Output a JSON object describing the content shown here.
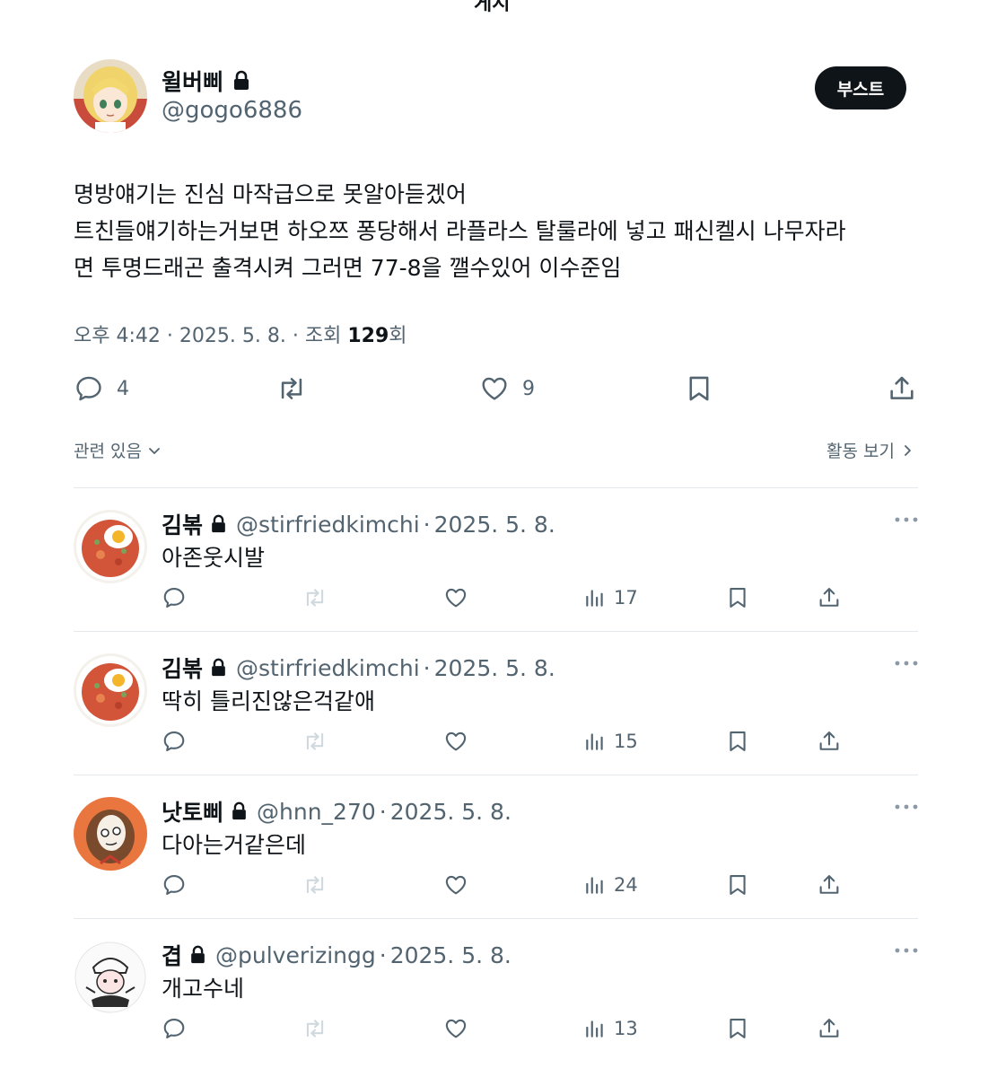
{
  "header_partial": "게시",
  "main_post": {
    "author_name": "윌버삐",
    "author_handle": "@gogo6886",
    "boost_label": "부스트",
    "text_lines": [
      "명방얘기는 진심 마작급으로 못알아듣겠어",
      "트친들얘기하는거보면 하오쯔 퐁당해서 라플라스 탈룰라에 넣고 패신켈시 나무자라",
      "면 투명드래곤 출격시켜 그러면 77-8을 깰수있어 이수준임"
    ],
    "time": "오후 4:42",
    "date": "2025. 5. 8.",
    "views_label": "조회",
    "views_count": "129",
    "views_suffix": "회",
    "reply_count": "4",
    "like_count": "9"
  },
  "filter": {
    "related_label": "관련 있음",
    "activity_label": "활동 보기"
  },
  "replies": [
    {
      "name": "김볶",
      "handle": "@stirfriedkimchi",
      "date": "2025. 5. 8.",
      "text": "아존웃시발",
      "views": "17",
      "avatar_icon": "kimchi-fried-rice-avatar"
    },
    {
      "name": "김볶",
      "handle": "@stirfriedkimchi",
      "date": "2025. 5. 8.",
      "text": "딱히 틀리진않은걱같애",
      "views": "15",
      "avatar_icon": "kimchi-fried-rice-avatar"
    },
    {
      "name": "낫토삐",
      "handle": "@hnn_270",
      "date": "2025. 5. 8.",
      "text": "다아는거같은데",
      "views": "24",
      "avatar_icon": "hooded-cartoon-avatar"
    },
    {
      "name": "겹",
      "handle": "@pulverizingg",
      "date": "2025. 5. 8.",
      "text": "개고수네",
      "views": "13",
      "avatar_icon": "sketch-character-avatar"
    }
  ],
  "colors": {
    "text_primary": "#0f1419",
    "text_secondary": "#536471",
    "divider": "#e6e9eb",
    "button_bg": "#0f1419"
  }
}
